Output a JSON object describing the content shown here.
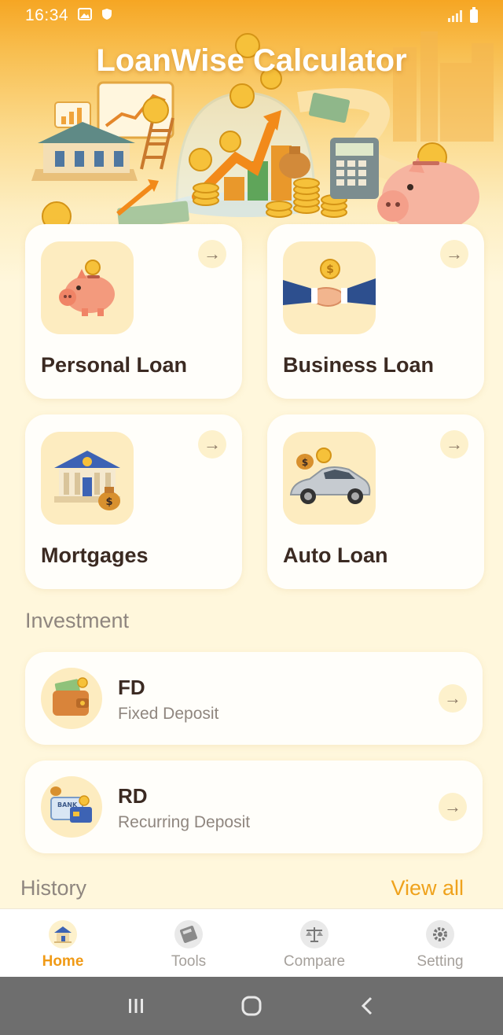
{
  "status_bar": {
    "time": "16:34"
  },
  "header": {
    "title": "LoanWise Calculator"
  },
  "loans": [
    {
      "label": "Personal Loan",
      "icon": "piggy-bank-icon"
    },
    {
      "label": "Business Loan",
      "icon": "handshake-icon"
    },
    {
      "label": "Mortgages",
      "icon": "bank-building-icon"
    },
    {
      "label": "Auto Loan",
      "icon": "car-icon"
    }
  ],
  "investment": {
    "section_title": "Investment",
    "items": [
      {
        "title": "FD",
        "subtitle": "Fixed Deposit",
        "icon": "wallet-icon"
      },
      {
        "title": "RD",
        "subtitle": "Recurring Deposit",
        "icon": "bank-card-icon"
      }
    ]
  },
  "history": {
    "section_title": "History",
    "view_all": "View all"
  },
  "bottom_nav": [
    {
      "label": "Home",
      "icon": "home-icon",
      "active": true
    },
    {
      "label": "Tools",
      "icon": "calculator-icon",
      "active": false
    },
    {
      "label": "Compare",
      "icon": "scale-icon",
      "active": false
    },
    {
      "label": "Setting",
      "icon": "gear-icon",
      "active": false
    }
  ],
  "colors": {
    "accent": "#f09a16",
    "background": "#fff7dc",
    "card": "#fffefa",
    "text_primary": "#3b2a22",
    "text_secondary": "#8f867f"
  }
}
